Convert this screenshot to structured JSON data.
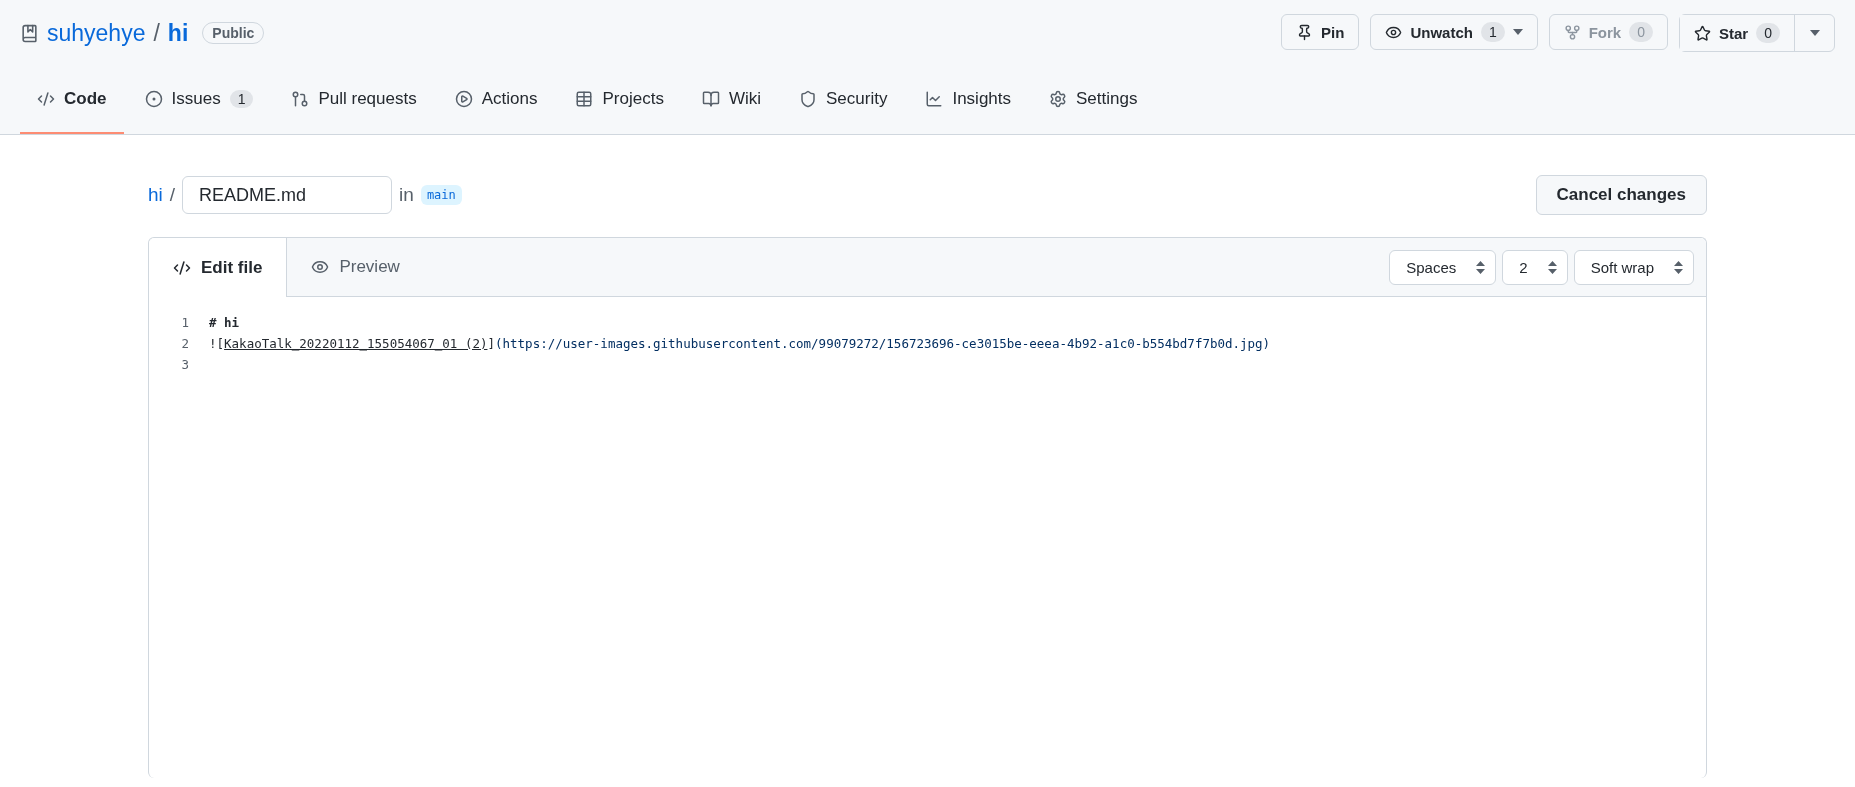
{
  "repo": {
    "owner": "suhyehye",
    "separator": "/",
    "name": "hi",
    "visibility": "Public"
  },
  "actions": [
    {
      "kind": "pin",
      "label": "Pin"
    },
    {
      "kind": "watch",
      "label": "Unwatch",
      "count": "1",
      "dropdown": true,
      "disabled": false
    },
    {
      "kind": "fork",
      "label": "Fork",
      "count": "0",
      "dropdown": false,
      "disabled": true
    },
    {
      "kind": "star",
      "label": "Star",
      "count": "0",
      "dropdown": true,
      "disabled": false
    }
  ],
  "tabs": [
    {
      "kind": "code",
      "label": "Code",
      "selected": true
    },
    {
      "kind": "issues",
      "label": "Issues",
      "count": "1",
      "selected": false
    },
    {
      "kind": "pulls",
      "label": "Pull requests",
      "selected": false
    },
    {
      "kind": "actions",
      "label": "Actions",
      "selected": false
    },
    {
      "kind": "projects",
      "label": "Projects",
      "selected": false
    },
    {
      "kind": "wiki",
      "label": "Wiki",
      "selected": false
    },
    {
      "kind": "security",
      "label": "Security",
      "selected": false
    },
    {
      "kind": "insights",
      "label": "Insights",
      "selected": false
    },
    {
      "kind": "settings",
      "label": "Settings",
      "selected": false
    }
  ],
  "path": {
    "repo": "hi",
    "separator": "/",
    "filename": "README.md",
    "in": "in",
    "branch": "main"
  },
  "cancel_button": "Cancel changes",
  "editor_tabs": [
    {
      "kind": "edit",
      "label": "Edit file",
      "selected": true
    },
    {
      "kind": "preview",
      "label": "Preview",
      "selected": false
    }
  ],
  "selects": [
    {
      "kind": "indent",
      "value": "Spaces"
    },
    {
      "kind": "size",
      "value": "2"
    },
    {
      "kind": "wrap",
      "value": "Soft wrap"
    }
  ],
  "lines": [
    {
      "number": "1",
      "tokens": [
        {
          "kind": "heading",
          "text": "# hi"
        }
      ]
    },
    {
      "number": "2",
      "tokens": [
        {
          "kind": "punct",
          "text": "!["
        },
        {
          "kind": "link",
          "text": "KakaoTalk_20220112_155054067_01 (2)"
        },
        {
          "kind": "punct",
          "text": "]"
        },
        {
          "kind": "url",
          "text": "(https://user-images.githubusercontent.com/99079272/156723696-ce3015be-eeea-4b92-a1c0-b554bd7f7b0d.jpg)"
        }
      ]
    },
    {
      "number": "3"
    }
  ]
}
